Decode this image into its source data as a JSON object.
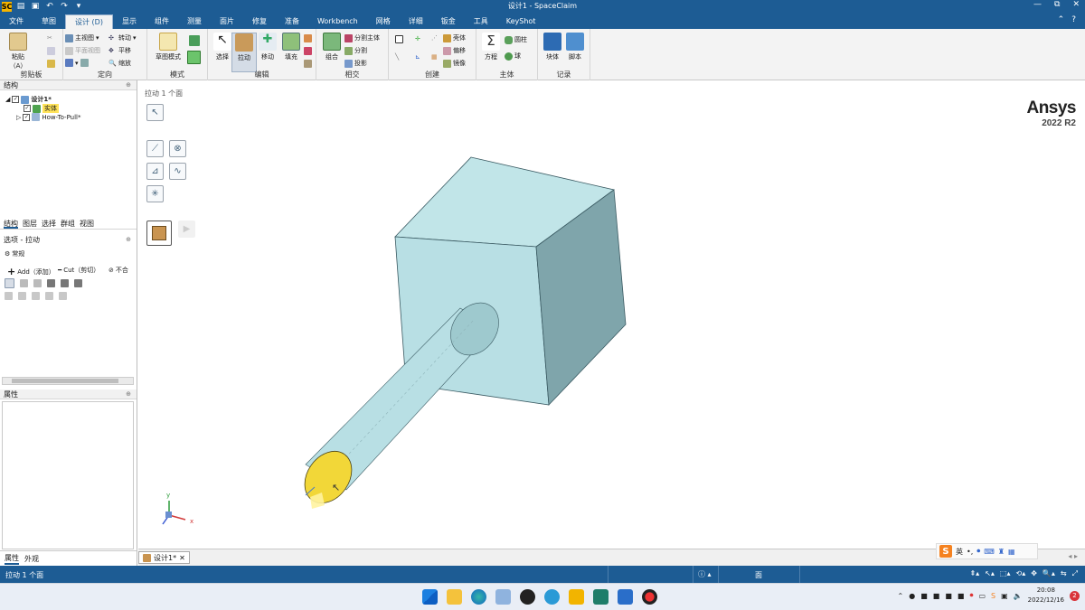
{
  "window": {
    "title": "设计1 - SpaceClaim",
    "app_logo": "SC",
    "min": "—",
    "restore": "⧉",
    "close": "✕"
  },
  "menu": {
    "tabs": [
      "文件",
      "草图",
      "设计 (D)",
      "显示",
      "组件",
      "测量",
      "面片",
      "修复",
      "准备",
      "Workbench",
      "网格",
      "详细",
      "钣金",
      "工具",
      "KeyShot"
    ],
    "active_index": 2
  },
  "ribbon": {
    "clipboard": {
      "label": "剪贴板",
      "paste": "粘贴（A）"
    },
    "orient": {
      "label": "定向",
      "home": "主视图",
      "plan": "平面视图",
      "spin": "转动",
      "pan": "平移",
      "zoom": "缩放"
    },
    "mode": {
      "label": "模式",
      "sketch": "草图模式"
    },
    "edit": {
      "label": "编辑",
      "select": "选择",
      "pull": "拉动",
      "move": "移动",
      "fill": "填充"
    },
    "intersect": {
      "label": "相交",
      "combine": "组合",
      "split_body": "分割主体",
      "split": "分割",
      "project": "投影"
    },
    "create": {
      "label": "创建",
      "shell": "壳体",
      "offset": "偏移",
      "mirror": "镜像"
    },
    "body": {
      "label": "主体",
      "equation": "方程",
      "cylinder": "圆柱",
      "sphere": "球"
    },
    "record": {
      "label": "记录",
      "block": "块体",
      "script": "脚本"
    }
  },
  "structure": {
    "title": "结构",
    "items": [
      {
        "label": "设计1*"
      },
      {
        "label": "实体"
      },
      {
        "label": "How-To-Pull*"
      }
    ]
  },
  "panel_tabs": [
    "结构",
    "图层",
    "选择",
    "群组",
    "视图"
  ],
  "options": {
    "title": "选项 - 拉动",
    "general": "常规",
    "add": "Add（添加）",
    "cut": "Cut（剪切）",
    "none": "不合"
  },
  "properties": {
    "title": "属性"
  },
  "bottom_tabs": [
    "属性",
    "外观"
  ],
  "viewport": {
    "status_label": "拉动 1 个面",
    "brand": "Ansys",
    "version": "2022 R2",
    "axis_x": "x",
    "axis_y": "y",
    "body_color": "#b7dfe3",
    "highlight_color": "#f2d738"
  },
  "doc_tab": {
    "label": "设计1*"
  },
  "ime": {
    "logo": "S",
    "lang": "英"
  },
  "status": {
    "text": "拉动 1 个面",
    "mid": "面"
  },
  "taskbar": {
    "time": "20:08",
    "date": "2022/12/16",
    "notifications": "2"
  }
}
